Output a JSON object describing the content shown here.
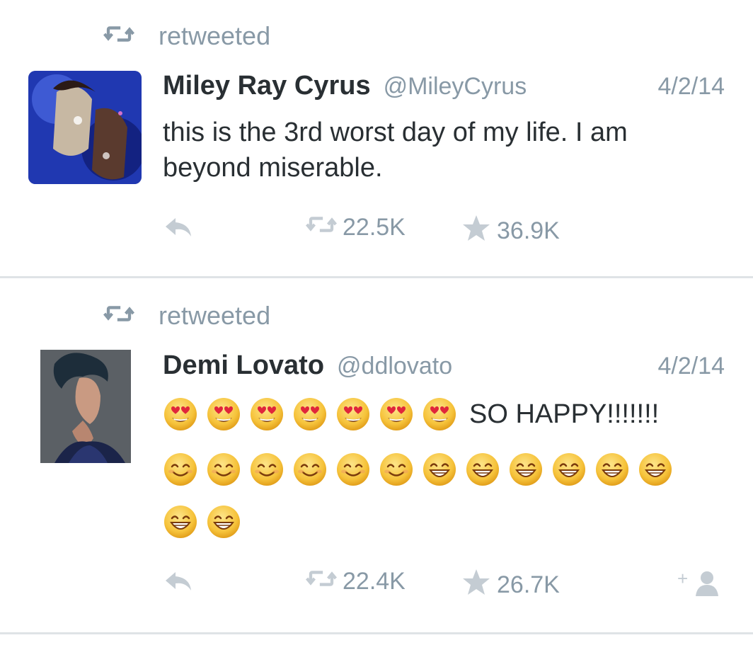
{
  "tweets": [
    {
      "retweet_label": "retweeted",
      "name": "Miley Ray Cyrus",
      "handle": "@MileyCyrus",
      "date": "4/2/14",
      "text": "this is the 3rd worst day of my life. I am beyond miserable.",
      "retweets": "22.5K",
      "favorites": "36.9K"
    },
    {
      "retweet_label": "retweeted",
      "name": "Demi Lovato",
      "handle": "@ddlovato",
      "date": "4/2/14",
      "text_suffix": "SO HAPPY!!!!!!!",
      "emoji_lines": [
        [
          "heart-eyes",
          "heart-eyes",
          "heart-eyes",
          "heart-eyes",
          "heart-eyes",
          "heart-eyes",
          "heart-eyes"
        ],
        [
          "smile",
          "smile",
          "smile",
          "smile",
          "smile",
          "smile",
          "grin",
          "grin",
          "grin",
          "grin",
          "grin",
          "grin"
        ],
        [
          "grin",
          "grin"
        ]
      ],
      "retweets": "22.4K",
      "favorites": "26.7K"
    }
  ],
  "colors": {
    "meta_gray": "#8899a6",
    "text": "#292f33",
    "divider": "#dfe3e6",
    "emoji_face": "#f6c33b"
  }
}
